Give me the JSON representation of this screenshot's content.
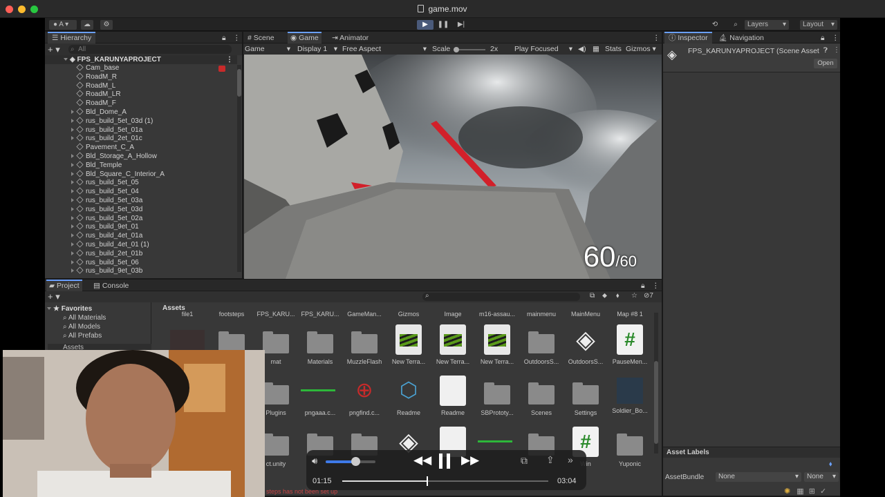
{
  "window": {
    "title": "game.mov"
  },
  "toolbar": {
    "account": "A",
    "layers": "Layers",
    "layout": "Layout"
  },
  "hierarchy": {
    "tab": "Hierarchy",
    "search_placeholder": "All",
    "root": "FPS_KARUNYAPROJECT",
    "items": [
      "Cam_base",
      "RoadM_R",
      "RoadM_L",
      "RoadM_LR",
      "RoadM_F",
      "Bld_Dome_A",
      "rus_build_5et_03d (1)",
      "rus_build_5et_01a",
      "rus_build_2et_01c",
      "Pavement_C_A",
      "Bld_Storage_A_Hollow",
      "Bld_Temple",
      "Bld_Square_C_Interior_A",
      "rus_build_5et_05",
      "rus_build_5et_04",
      "rus_build_5et_03a",
      "rus_build_5et_03d",
      "rus_build_5et_02a",
      "rus_build_9et_01",
      "rus_build_4et_01a",
      "rus_build_4et_01 (1)",
      "rus_build_2et_01b",
      "rus_build_5et_06",
      "rus_build_9et_03b"
    ],
    "expandable": [
      false,
      false,
      false,
      false,
      false,
      true,
      true,
      true,
      true,
      false,
      true,
      true,
      true,
      true,
      true,
      true,
      true,
      true,
      true,
      true,
      true,
      true,
      true,
      true
    ]
  },
  "scene_tabs": {
    "scene": "Scene",
    "game": "Game",
    "animator": "Animator"
  },
  "game_bar": {
    "mode": "Game",
    "display": "Display 1",
    "aspect": "Free Aspect",
    "scale_label": "Scale",
    "scale_value": "2x",
    "play_focused": "Play Focused",
    "stats": "Stats",
    "gizmos": "Gizmos"
  },
  "hud": {
    "ammo": "60",
    "ammo_max": "/60"
  },
  "inspector": {
    "tab": "Inspector",
    "nav_tab": "Navigation",
    "object": "FPS_KARUNYAPROJECT (Scene Asset",
    "open": "Open",
    "asset_labels": "Asset Labels",
    "asset_bundle": "AssetBundle",
    "bundle_value": "None",
    "bundle_variant": "None"
  },
  "project": {
    "tab": "Project",
    "console_tab": "Console",
    "favorites": "Favorites",
    "fav_items": [
      "All Materials",
      "All Models",
      "All Prefabs"
    ],
    "assets_root": "Assets",
    "assets_header": "Assets",
    "assets_count": "7",
    "row1": [
      "file1",
      "footsteps",
      "FPS_KARU...",
      "FPS_KARU...",
      "GameMan...",
      "Gizmos",
      "Image",
      "m16-assau...",
      "mainmenu",
      "MainMenu",
      "Map #8 1"
    ],
    "row2": [
      "mat",
      "Materials",
      "MuzzleFlash",
      "New Terra...",
      "New Terra...",
      "New Terra...",
      "OutdoorsS...",
      "OutdoorsS...",
      "PauseMen..."
    ],
    "row3": [
      "Plugins",
      "pngaaa.c...",
      "pngfind.c...",
      "Readme",
      "Readme",
      "SBPrototy...",
      "Scenes",
      "Settings",
      "Soldier_Bo..."
    ],
    "row4": [
      "ct.unity",
      "Win",
      "Yuponic"
    ],
    "status": "steps has not been set up"
  },
  "player": {
    "current": "01:15",
    "total": "03:04",
    "progress": 0.41,
    "volume": 0.6
  }
}
